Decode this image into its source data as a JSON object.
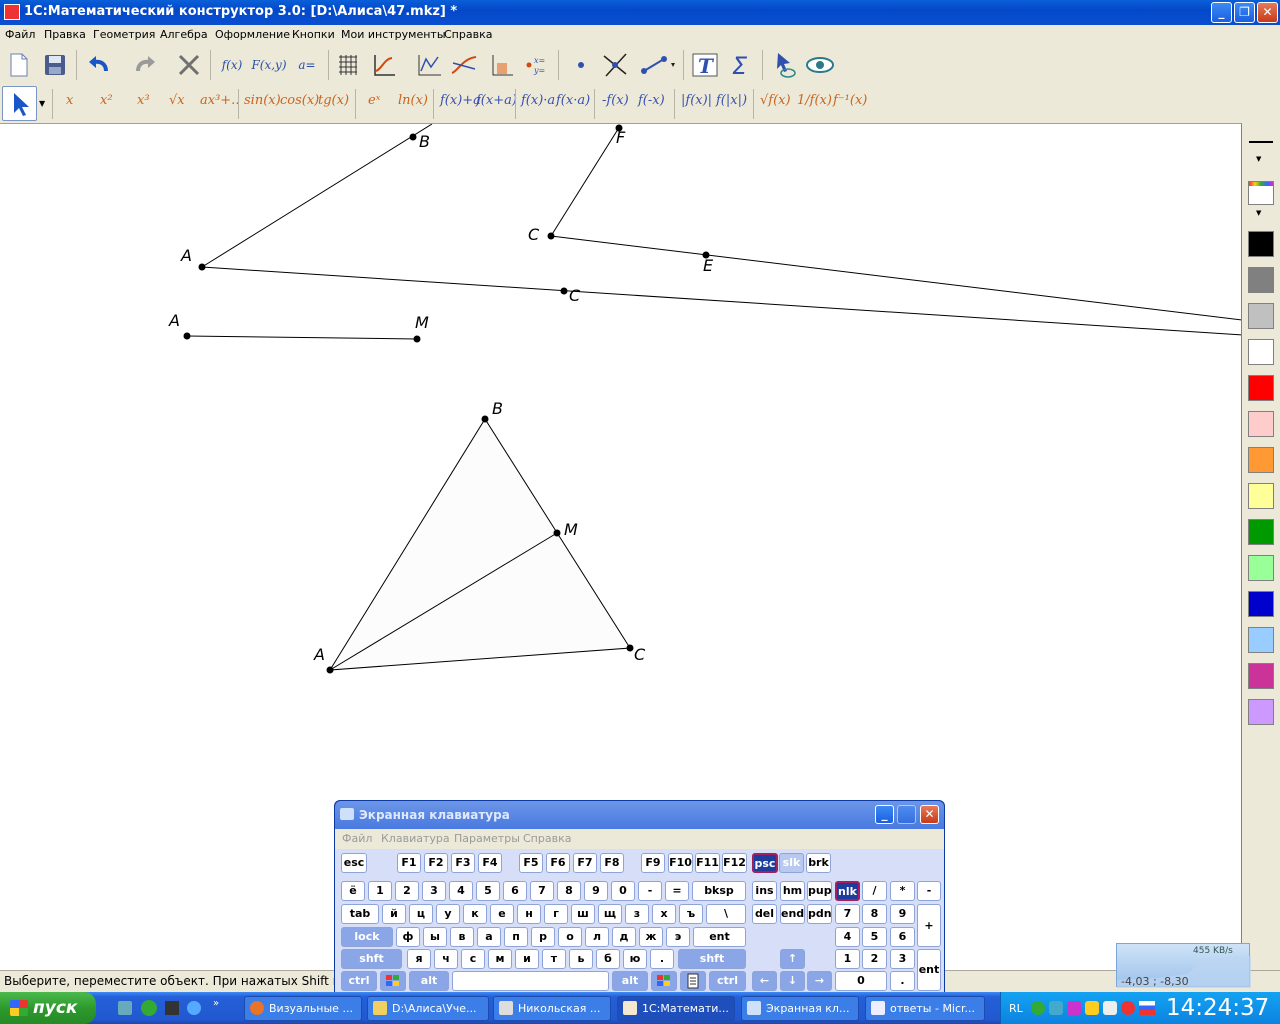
{
  "window": {
    "title": "1С:Математический конструктор 3.0: [D:\\Алиса\\47.mkz] *",
    "min_glyph": "_",
    "restore_glyph": "❐",
    "close_glyph": "✕"
  },
  "menu": [
    "Файл",
    "Правка",
    "Геометрия",
    "Алгебра",
    "Оформление",
    "Кнопки",
    "Мои инструменты",
    "Справка"
  ],
  "toolbar1": {
    "fx": "f(x)",
    "fxy": "F(x,y)",
    "aeq": "a="
  },
  "toolbar2": {
    "items": [
      "x",
      "x²",
      "x³",
      "√x",
      "ax³+..",
      "sin(x)",
      "cos(x)",
      "tg(x)",
      "eˣ",
      "ln(x)",
      "f(x)+a",
      "f(x+a)",
      "f(x)·a",
      "f(x·a)",
      "-f(x)",
      "f(-x)",
      "|f(x)|",
      "f(|x|)",
      "√f(x)",
      "1/f(x)",
      "f⁻¹(x)"
    ]
  },
  "drawing": {
    "labels": [
      {
        "text": "B"
      },
      {
        "text": "F"
      },
      {
        "text": "A"
      },
      {
        "text": "C"
      },
      {
        "text": "E"
      },
      {
        "text": "C"
      },
      {
        "text": "A"
      },
      {
        "text": "M"
      },
      {
        "text": "B"
      },
      {
        "text": "M"
      },
      {
        "text": "A"
      },
      {
        "text": "C"
      }
    ]
  },
  "palette": {
    "colors": [
      "#000000",
      "#808080",
      "#c0c0c0",
      "#ffffff",
      "#ff0000",
      "#ffcccc",
      "#ff9933",
      "#ffff99",
      "#009900",
      "#99ff99",
      "#0000cc",
      "#99ccff",
      "#cc3399",
      "#cc99ff"
    ]
  },
  "status": {
    "message": "Выберите, переместите объект. При нажатых Shift или Ctr",
    "coords": "-4,03 ; -8,30",
    "net": "455 KB/s"
  },
  "osk": {
    "title": "Экранная клавиатура",
    "menu": [
      "Файл",
      "Клавиатура",
      "Параметры",
      "Справка"
    ],
    "rows": {
      "fn": [
        "esc",
        "F1",
        "F2",
        "F3",
        "F4",
        "F5",
        "F6",
        "F7",
        "F8",
        "F9",
        "F10",
        "F11",
        "F12",
        "psc",
        "slk",
        "brk"
      ],
      "num": [
        "ё",
        "1",
        "2",
        "3",
        "4",
        "5",
        "6",
        "7",
        "8",
        "9",
        "0",
        "-",
        "=",
        "bksp",
        "ins",
        "hm",
        "pup",
        "nlk",
        "/",
        "*",
        "-"
      ],
      "top": [
        "tab",
        "й",
        "ц",
        "у",
        "к",
        "е",
        "н",
        "г",
        "ш",
        "щ",
        "з",
        "х",
        "ъ",
        "\\",
        "del",
        "end",
        "pdn",
        "7",
        "8",
        "9",
        "+"
      ],
      "mid": [
        "lock",
        "ф",
        "ы",
        "в",
        "а",
        "п",
        "р",
        "о",
        "л",
        "д",
        "ж",
        "э",
        "ent",
        "4",
        "5",
        "6"
      ],
      "low": [
        "shft",
        "я",
        "ч",
        "с",
        "м",
        "и",
        "т",
        "ь",
        "б",
        "ю",
        ".",
        "shft",
        "↑",
        "1",
        "2",
        "3",
        "ent"
      ],
      "bot": [
        "ctrl",
        "alt",
        "alt",
        "ctrl",
        "←",
        "↓",
        "→",
        "0",
        "."
      ]
    }
  },
  "taskbar": {
    "start": "пуск",
    "tasks": [
      "Визуальные ...",
      "D:\\Алиса\\Уче...",
      "Никольская ...",
      "1С:Математи...",
      "Экранная кл...",
      "ответы - Micr..."
    ],
    "lang": "RL",
    "clock": "14:24:37"
  }
}
